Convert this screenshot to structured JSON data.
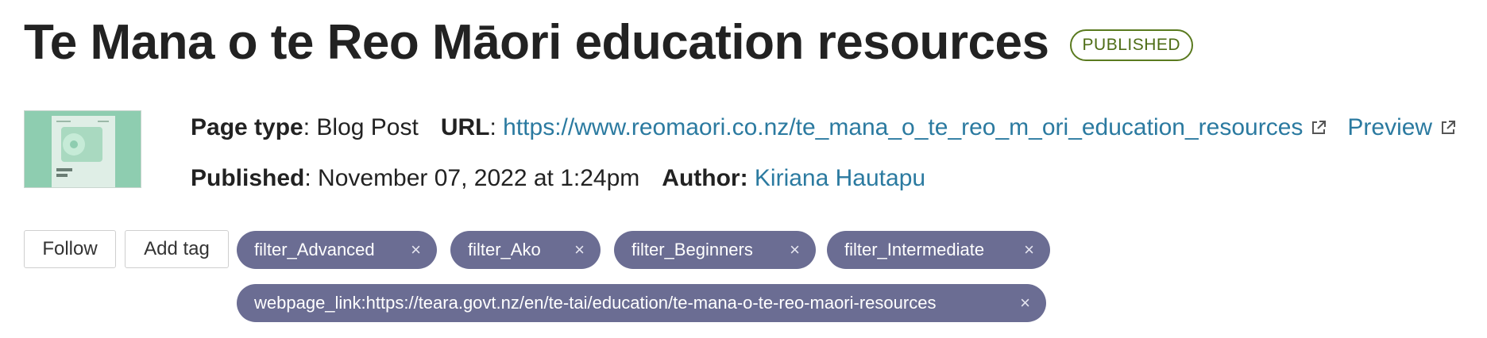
{
  "header": {
    "title": "Te Mana o te Reo Māori education resources",
    "status": "PUBLISHED"
  },
  "meta": {
    "page_type_label": "Page type",
    "page_type_value": "Blog Post",
    "url_label": "URL",
    "url_value": "https://www.reomaori.co.nz/te_mana_o_te_reo_m_ori_education_resources",
    "preview_label": "Preview",
    "published_label": "Published",
    "published_value": "November 07, 2022 at 1:24pm",
    "author_label": "Author:",
    "author_value": "Kiriana Hautapu"
  },
  "actions": {
    "follow_label": "Follow",
    "add_tag_label": "Add tag"
  },
  "tags": [
    "filter_Advanced",
    "filter_Ako",
    "filter_Beginners",
    "filter_Intermediate",
    "webpage_link:https://teara.govt.nz/en/te-tai/education/te-mana-o-te-reo-maori-resources"
  ],
  "tag_remove_glyph": "×",
  "colors": {
    "link": "#2b7aa0",
    "tag_bg": "#6b6d93",
    "badge": "#5a7a1f",
    "thumbnail_bg": "#8ecdb0"
  }
}
